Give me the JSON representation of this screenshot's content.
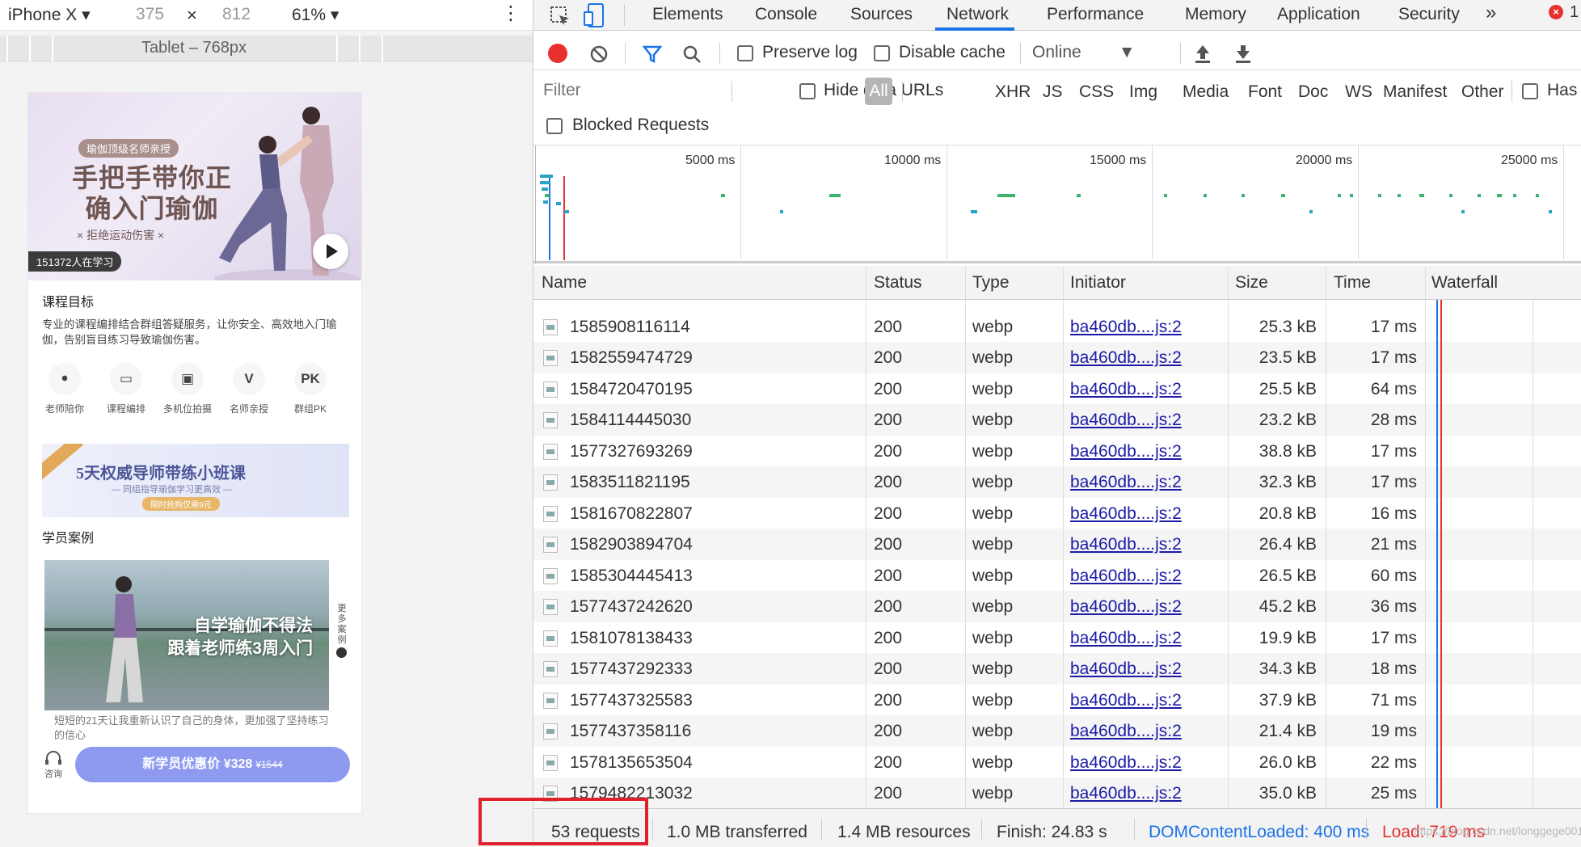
{
  "device_toolbar": {
    "device": "iPhone X",
    "width": "375",
    "times": "×",
    "height": "812",
    "zoom": "61%",
    "media_query_label": "Tablet – 768px"
  },
  "phone": {
    "hero": {
      "tag": "瑜伽顶级名师亲授",
      "title": "手把手带你正确入门瑜伽",
      "subtitle": "× 拒绝运动伤害 ×",
      "learners": "151372人在学习"
    },
    "goal_title": "课程目标",
    "goal_desc": "专业的课程编排结合群组答疑服务，让你安全、高效地入门瑜伽，告别盲目练习导致瑜伽伤害。",
    "features": [
      {
        "icon": "ꔷ",
        "label": "老师陪你"
      },
      {
        "icon": "▭",
        "label": "课程编排"
      },
      {
        "icon": "▣",
        "label": "多机位拍摄"
      },
      {
        "icon": "V",
        "label": "名师亲授"
      },
      {
        "icon": "PK",
        "label": "群组PK"
      }
    ],
    "banner": {
      "title": "5天权威导师带练小班课",
      "sub": "— 同组指导瑜伽学习更高效 —",
      "badge": "限时抢购仅需9元"
    },
    "cases_title": "学员案例",
    "case": {
      "line1": "自学瑜伽不得法",
      "line2": "跟着老师练3周入门",
      "more": "更多案例",
      "text": "短短的21天让我重新认识了自己的身体，更加强了坚持练习的信心"
    },
    "bottom": {
      "consult": "咨询",
      "buy_label": "新学员优惠价 ¥328",
      "orig_price": "¥1544"
    }
  },
  "devtools": {
    "tabs": [
      "Elements",
      "Console",
      "Sources",
      "Network",
      "Performance",
      "Memory",
      "Application",
      "Security"
    ],
    "active_tab": "Network",
    "more_tabs": "»",
    "error_count": "1",
    "toolbar": {
      "preserve_log": "Preserve log",
      "disable_cache": "Disable cache",
      "throttle": "Online"
    },
    "filter": {
      "placeholder": "Filter",
      "hide_data_urls": "Hide data URLs",
      "types": [
        "All",
        "XHR",
        "JS",
        "CSS",
        "Img",
        "Media",
        "Font",
        "Doc",
        "WS",
        "Manifest",
        "Other"
      ],
      "has_blocked": "Has bl",
      "blocked_requests": "Blocked Requests"
    },
    "overview_labels": [
      "5000 ms",
      "10000 ms",
      "15000 ms",
      "20000 ms",
      "25000 ms"
    ],
    "columns": [
      "Name",
      "Status",
      "Type",
      "Initiator",
      "Size",
      "Time",
      "Waterfall"
    ],
    "rows": [
      {
        "name": "1585908116114",
        "status": "200",
        "type": "webp",
        "initiator": "ba460db....js:2",
        "size": "25.3 kB",
        "time": "17 ms"
      },
      {
        "name": "1582559474729",
        "status": "200",
        "type": "webp",
        "initiator": "ba460db....js:2",
        "size": "23.5 kB",
        "time": "17 ms"
      },
      {
        "name": "1584720470195",
        "status": "200",
        "type": "webp",
        "initiator": "ba460db....js:2",
        "size": "25.5 kB",
        "time": "64 ms"
      },
      {
        "name": "1584114445030",
        "status": "200",
        "type": "webp",
        "initiator": "ba460db....js:2",
        "size": "23.2 kB",
        "time": "28 ms"
      },
      {
        "name": "1577327693269",
        "status": "200",
        "type": "webp",
        "initiator": "ba460db....js:2",
        "size": "38.8 kB",
        "time": "17 ms"
      },
      {
        "name": "1583511821195",
        "status": "200",
        "type": "webp",
        "initiator": "ba460db....js:2",
        "size": "32.3 kB",
        "time": "17 ms"
      },
      {
        "name": "1581670822807",
        "status": "200",
        "type": "webp",
        "initiator": "ba460db....js:2",
        "size": "20.8 kB",
        "time": "16 ms"
      },
      {
        "name": "1582903894704",
        "status": "200",
        "type": "webp",
        "initiator": "ba460db....js:2",
        "size": "26.4 kB",
        "time": "21 ms"
      },
      {
        "name": "1585304445413",
        "status": "200",
        "type": "webp",
        "initiator": "ba460db....js:2",
        "size": "26.5 kB",
        "time": "60 ms"
      },
      {
        "name": "1577437242620",
        "status": "200",
        "type": "webp",
        "initiator": "ba460db....js:2",
        "size": "45.2 kB",
        "time": "36 ms"
      },
      {
        "name": "1581078138433",
        "status": "200",
        "type": "webp",
        "initiator": "ba460db....js:2",
        "size": "19.9 kB",
        "time": "17 ms"
      },
      {
        "name": "1577437292333",
        "status": "200",
        "type": "webp",
        "initiator": "ba460db....js:2",
        "size": "34.3 kB",
        "time": "18 ms"
      },
      {
        "name": "1577437325583",
        "status": "200",
        "type": "webp",
        "initiator": "ba460db....js:2",
        "size": "37.9 kB",
        "time": "71 ms"
      },
      {
        "name": "1577437358116",
        "status": "200",
        "type": "webp",
        "initiator": "ba460db....js:2",
        "size": "21.4 kB",
        "time": "19 ms"
      },
      {
        "name": "1578135653504",
        "status": "200",
        "type": "webp",
        "initiator": "ba460db....js:2",
        "size": "26.0 kB",
        "time": "22 ms"
      },
      {
        "name": "1579482213032",
        "status": "200",
        "type": "webp",
        "initiator": "ba460db....js:2",
        "size": "35.0 kB",
        "time": "25 ms"
      }
    ],
    "status_bar": {
      "requests": "53 requests",
      "transferred": "1.0 MB transferred",
      "resources": "1.4 MB resources",
      "finish": "Finish: 24.83 s",
      "dcl": "DOMContentLoaded: 400 ms",
      "load": "Load: 719 ms"
    },
    "watermark": "https://blog.csdn.net/longgege001"
  },
  "colors": {
    "accent": "#1a73e8",
    "record": "#e8312f",
    "dcl": "#1a73e8",
    "load": "#e8312f",
    "buy_button": "#8e9af0"
  }
}
